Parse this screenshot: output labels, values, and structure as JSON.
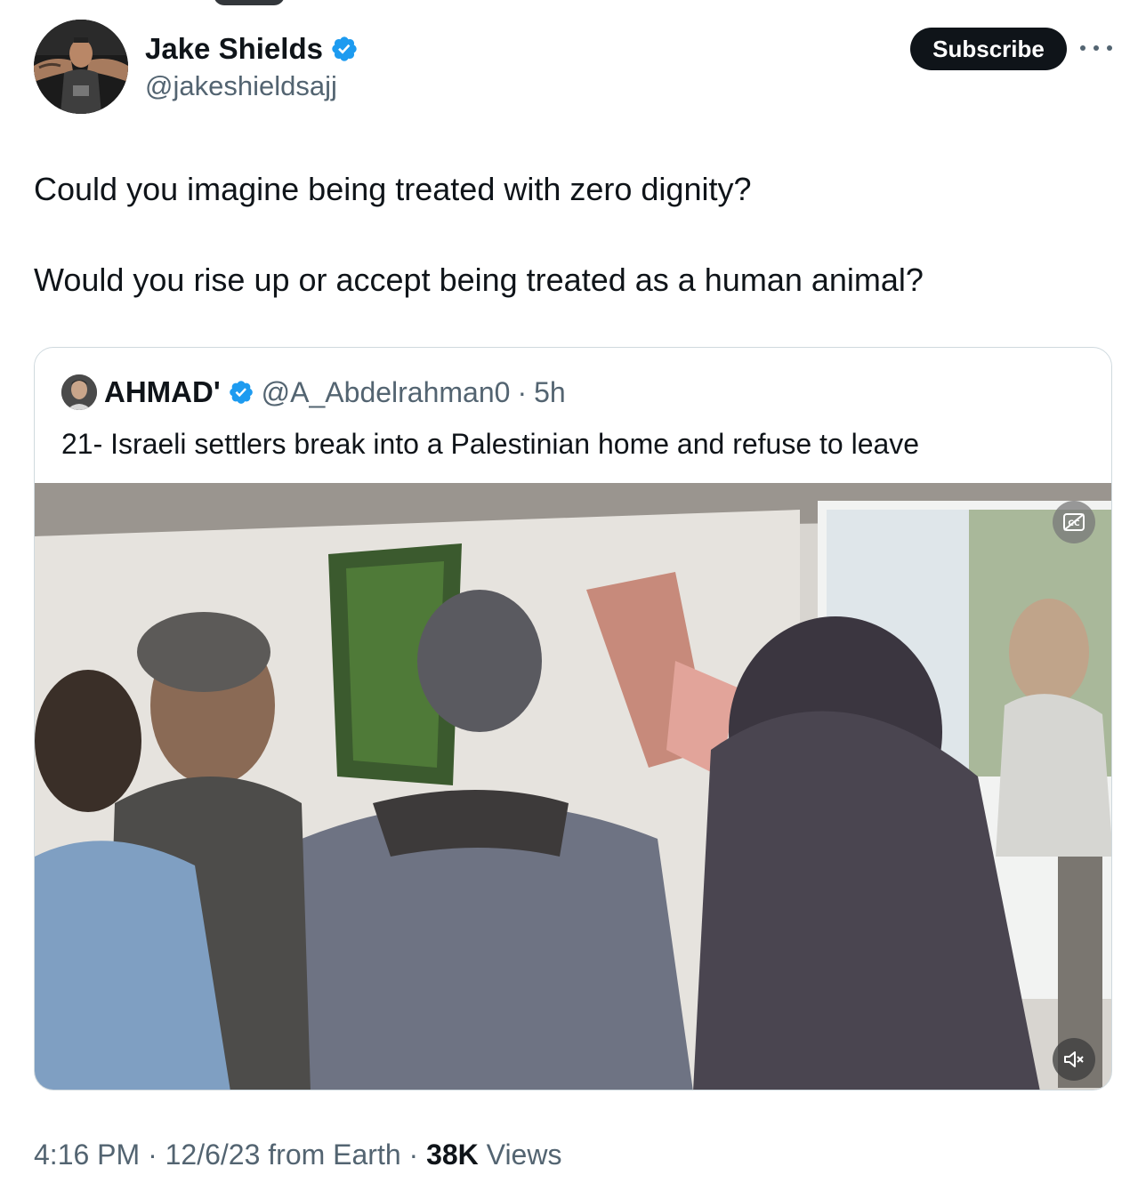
{
  "tweet": {
    "author": {
      "name": "Jake Shields",
      "handle": "@jakeshieldsajj",
      "verified": true
    },
    "subscribe_label": "Subscribe",
    "text_paragraphs": [
      "Could you imagine being treated with zero dignity?",
      "Would you rise up or accept being treated as a human animal?"
    ],
    "quote": {
      "author_name": "AHMAD'",
      "author_handle": "@A_Abdelrahman0",
      "separator": "·",
      "time": "5h",
      "verified": true,
      "text": "21- Israeli settlers break into a Palestinian home and refuse to leave",
      "media_icons": [
        "captions-icon",
        "mute-icon"
      ]
    },
    "meta": {
      "time": "4:16 PM",
      "sep1": " · ",
      "date": "12/6/23 from Earth",
      "sep2": " · ",
      "views_count": "38K",
      "views_label": " Views"
    }
  },
  "colors": {
    "text_primary": "#0f1419",
    "text_secondary": "#536471",
    "verified_blue": "#1d9bf0",
    "border": "#cfd9de",
    "button_dark": "#0f1419"
  }
}
